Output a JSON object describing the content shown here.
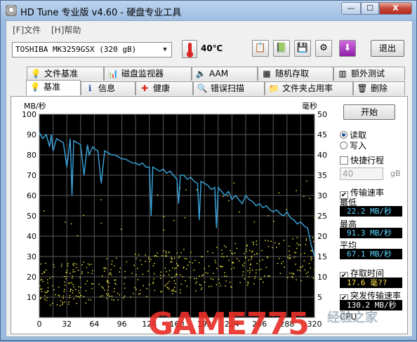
{
  "window": {
    "title": "HD Tune 专业版 v4.60 - 硬盘专业工具",
    "min_label": "—",
    "max_label": "☐",
    "close_label": "X"
  },
  "menu": {
    "items": [
      "[F]文件",
      "[H]帮助"
    ]
  },
  "toolbar": {
    "drive": "TOSHIBA MK3259GSX (320 gB)",
    "temperature": "40℃",
    "exit_label": "退出"
  },
  "tabs_top": [
    {
      "label": "文件基准",
      "icon": "file-benchmark-icon",
      "glyph": "💡"
    },
    {
      "label": "磁盘监视器",
      "icon": "disk-monitor-icon",
      "glyph": "📊"
    },
    {
      "label": "AAM",
      "icon": "speaker-icon",
      "glyph": "🔈"
    },
    {
      "label": "随机存取",
      "icon": "random-access-icon",
      "glyph": "▦"
    },
    {
      "label": "额外测试",
      "icon": "extra-tests-icon",
      "glyph": "▥"
    }
  ],
  "tabs_bottom": [
    {
      "label": "基准",
      "icon": "benchmark-icon",
      "glyph": "💡"
    },
    {
      "label": "信息",
      "icon": "info-icon",
      "glyph": "ℹ"
    },
    {
      "label": "健康",
      "icon": "health-cross-icon",
      "glyph": "✚"
    },
    {
      "label": "错误扫描",
      "icon": "magnifier-icon",
      "glyph": "🔍"
    },
    {
      "label": "文件夹占用率",
      "icon": "folder-icon",
      "glyph": "📁"
    },
    {
      "label": "删除",
      "icon": "trash-icon",
      "glyph": "🗑"
    }
  ],
  "side": {
    "start_label": "开始",
    "read_label": "读取",
    "write_label": "写入",
    "quick_label": "快捷行程",
    "quick_value": "40",
    "quick_unit": "gB",
    "transfer_label": "传输速率",
    "min_label": "最低",
    "min_value": "22.2 MB/秒",
    "max_label": "最高",
    "max_value": "91.3 MB/秒",
    "avg_label": "平均",
    "avg_value": "67.1 MB/秒",
    "access_label": "存取时间",
    "access_value": "17.6 毫??",
    "burst_label": "突发传输速率",
    "burst_value": "130.2 MB/秒",
    "cpu_label": "CPU"
  },
  "chart_data": {
    "type": "line",
    "y_left_label": "MB/秒",
    "y_right_label": "毫秒",
    "y_left_ticks": [
      10,
      20,
      30,
      40,
      50,
      60,
      70,
      80,
      90,
      100
    ],
    "y_right_ticks": [
      5,
      10,
      15,
      20,
      25,
      30,
      35,
      40,
      45,
      50
    ],
    "x_ticks": [
      0,
      32,
      64,
      96,
      128,
      160,
      192,
      224,
      256,
      288,
      320
    ],
    "ylim": [
      0,
      100
    ],
    "xlim": [
      0,
      320
    ],
    "grid": true,
    "series": [
      {
        "name": "传输速率",
        "color": "#3aa7e0",
        "x": [
          0,
          4,
          8,
          12,
          14,
          16,
          20,
          24,
          28,
          32,
          36,
          38,
          40,
          44,
          48,
          52,
          56,
          58,
          62,
          64,
          68,
          72,
          76,
          80,
          84,
          88,
          92,
          96,
          100,
          104,
          108,
          112,
          116,
          120,
          124,
          128,
          130,
          132,
          136,
          140,
          144,
          148,
          152,
          156,
          160,
          162,
          164,
          168,
          172,
          176,
          180,
          184,
          186,
          188,
          192,
          196,
          200,
          204,
          206,
          208,
          212,
          216,
          220,
          224,
          228,
          232,
          236,
          240,
          244,
          248,
          252,
          256,
          260,
          264,
          268,
          272,
          276,
          280,
          284,
          288,
          292,
          296,
          300,
          304,
          308,
          312,
          316,
          320
        ],
        "y": [
          91,
          88,
          90,
          84,
          90,
          82,
          88,
          87,
          86,
          74,
          88,
          60,
          87,
          86,
          85,
          70,
          85,
          80,
          84,
          83,
          82,
          66,
          82,
          81,
          80,
          80,
          79,
          78,
          78,
          77,
          76,
          76,
          75,
          76,
          74,
          74,
          50,
          74,
          73,
          72,
          73,
          71,
          72,
          70,
          68,
          56,
          70,
          70,
          68,
          69,
          67,
          66,
          48,
          67,
          66,
          65,
          63,
          64,
          44,
          64,
          62,
          60,
          62,
          58,
          60,
          58,
          56,
          60,
          58,
          57,
          55,
          56,
          54,
          55,
          53,
          52,
          53,
          51,
          50,
          52,
          49,
          48,
          46,
          47,
          45,
          44,
          36,
          30
        ]
      },
      {
        "name": "存取时间",
        "color": "#e6e23a",
        "type": "scatter",
        "x_range": [
          0,
          320
        ],
        "y_range_ms": [
          8,
          32
        ]
      }
    ]
  },
  "watermark": {
    "text": "GAME775",
    "sub": "经验之家"
  }
}
